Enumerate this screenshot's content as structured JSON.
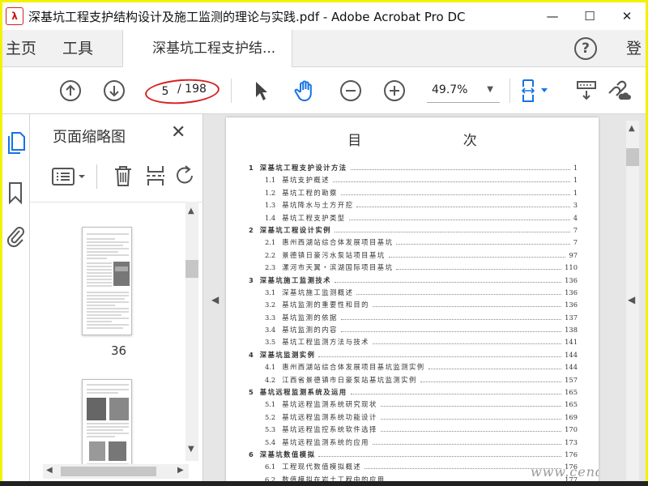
{
  "window": {
    "title": "深基坑工程支护结构设计及施工监测的理论与实践.pdf - Adobe Acrobat Pro DC",
    "app_icon": "acrobat-logo",
    "logo_text": "λ",
    "minimize": "—",
    "maximize": "☐",
    "close": "✕"
  },
  "menubar": {
    "home": "主页",
    "tools": "工具",
    "doc_tab": "深基坑工程支护结...",
    "help": "?",
    "login": "登"
  },
  "toolbar": {
    "page_current": "5",
    "page_total": "/ 198",
    "zoom": "49.7%",
    "accent": "#1473e6",
    "highlight": "#d62020"
  },
  "panel": {
    "title": "页面缩略图",
    "close": "✕",
    "thumbs": [
      {
        "label": "36"
      }
    ]
  },
  "toc": {
    "title": "目 次",
    "rows": [
      {
        "kind": "ch",
        "num": "1",
        "text": "深基坑工程支护设计方法",
        "page": "1"
      },
      {
        "kind": "sec",
        "num": "1.1",
        "text": "基坑支护概述",
        "page": "1"
      },
      {
        "kind": "sec",
        "num": "1.2",
        "text": "基坑工程的勘察",
        "page": "1"
      },
      {
        "kind": "sec",
        "num": "1.3",
        "text": "基坑降水与土方开挖",
        "page": "3"
      },
      {
        "kind": "sec",
        "num": "1.4",
        "text": "基坑工程支护类型",
        "page": "4"
      },
      {
        "kind": "ch",
        "num": "2",
        "text": "深基坑工程设计实例",
        "page": "7"
      },
      {
        "kind": "sec",
        "num": "2.1",
        "text": "惠州西湖站综合体发展项目基坑",
        "page": "7"
      },
      {
        "kind": "sec",
        "num": "2.2",
        "text": "景德镇日豪污水泵站项目基坑",
        "page": "97"
      },
      {
        "kind": "sec",
        "num": "2.3",
        "text": "漯河市天翼・滨湖国际项目基坑",
        "page": "110"
      },
      {
        "kind": "ch",
        "num": "3",
        "text": "深基坑施工监测技术",
        "page": "136"
      },
      {
        "kind": "sec",
        "num": "3.1",
        "text": "深基坑施工监测概述",
        "page": "136"
      },
      {
        "kind": "sec",
        "num": "3.2",
        "text": "基坑监测的重要性和目的",
        "page": "136"
      },
      {
        "kind": "sec",
        "num": "3.3",
        "text": "基坑监测的依据",
        "page": "137"
      },
      {
        "kind": "sec",
        "num": "3.4",
        "text": "基坑监测的内容",
        "page": "138"
      },
      {
        "kind": "sec",
        "num": "3.5",
        "text": "基坑工程监测方法与技术",
        "page": "141"
      },
      {
        "kind": "ch",
        "num": "4",
        "text": "深基坑监测实例",
        "page": "144"
      },
      {
        "kind": "sec",
        "num": "4.1",
        "text": "惠州西湖站综合体发展项目基坑监测实例",
        "page": "144"
      },
      {
        "kind": "sec",
        "num": "4.2",
        "text": "江西省景德镇市日豪泵站基坑监测实例",
        "page": "157"
      },
      {
        "kind": "ch",
        "num": "5",
        "text": "基坑远程监测系统及运用",
        "page": "165"
      },
      {
        "kind": "sec",
        "num": "5.1",
        "text": "基坑远程监测系统研究现状",
        "page": "165"
      },
      {
        "kind": "sec",
        "num": "5.2",
        "text": "基坑远程监测系统功能设计",
        "page": "169"
      },
      {
        "kind": "sec",
        "num": "5.3",
        "text": "基坑远程监控系统软件选择",
        "page": "170"
      },
      {
        "kind": "sec",
        "num": "5.4",
        "text": "基坑远程监测系统的应用",
        "page": "173"
      },
      {
        "kind": "ch",
        "num": "6",
        "text": "深基坑数值模拟",
        "page": "176"
      },
      {
        "kind": "sec",
        "num": "6.1",
        "text": "工程现代数值模拟概述",
        "page": "176"
      },
      {
        "kind": "sec",
        "num": "6.2",
        "text": "数值模拟在岩土工程中的应用",
        "page": "177"
      }
    ]
  },
  "watermark": "www.cendao.com"
}
